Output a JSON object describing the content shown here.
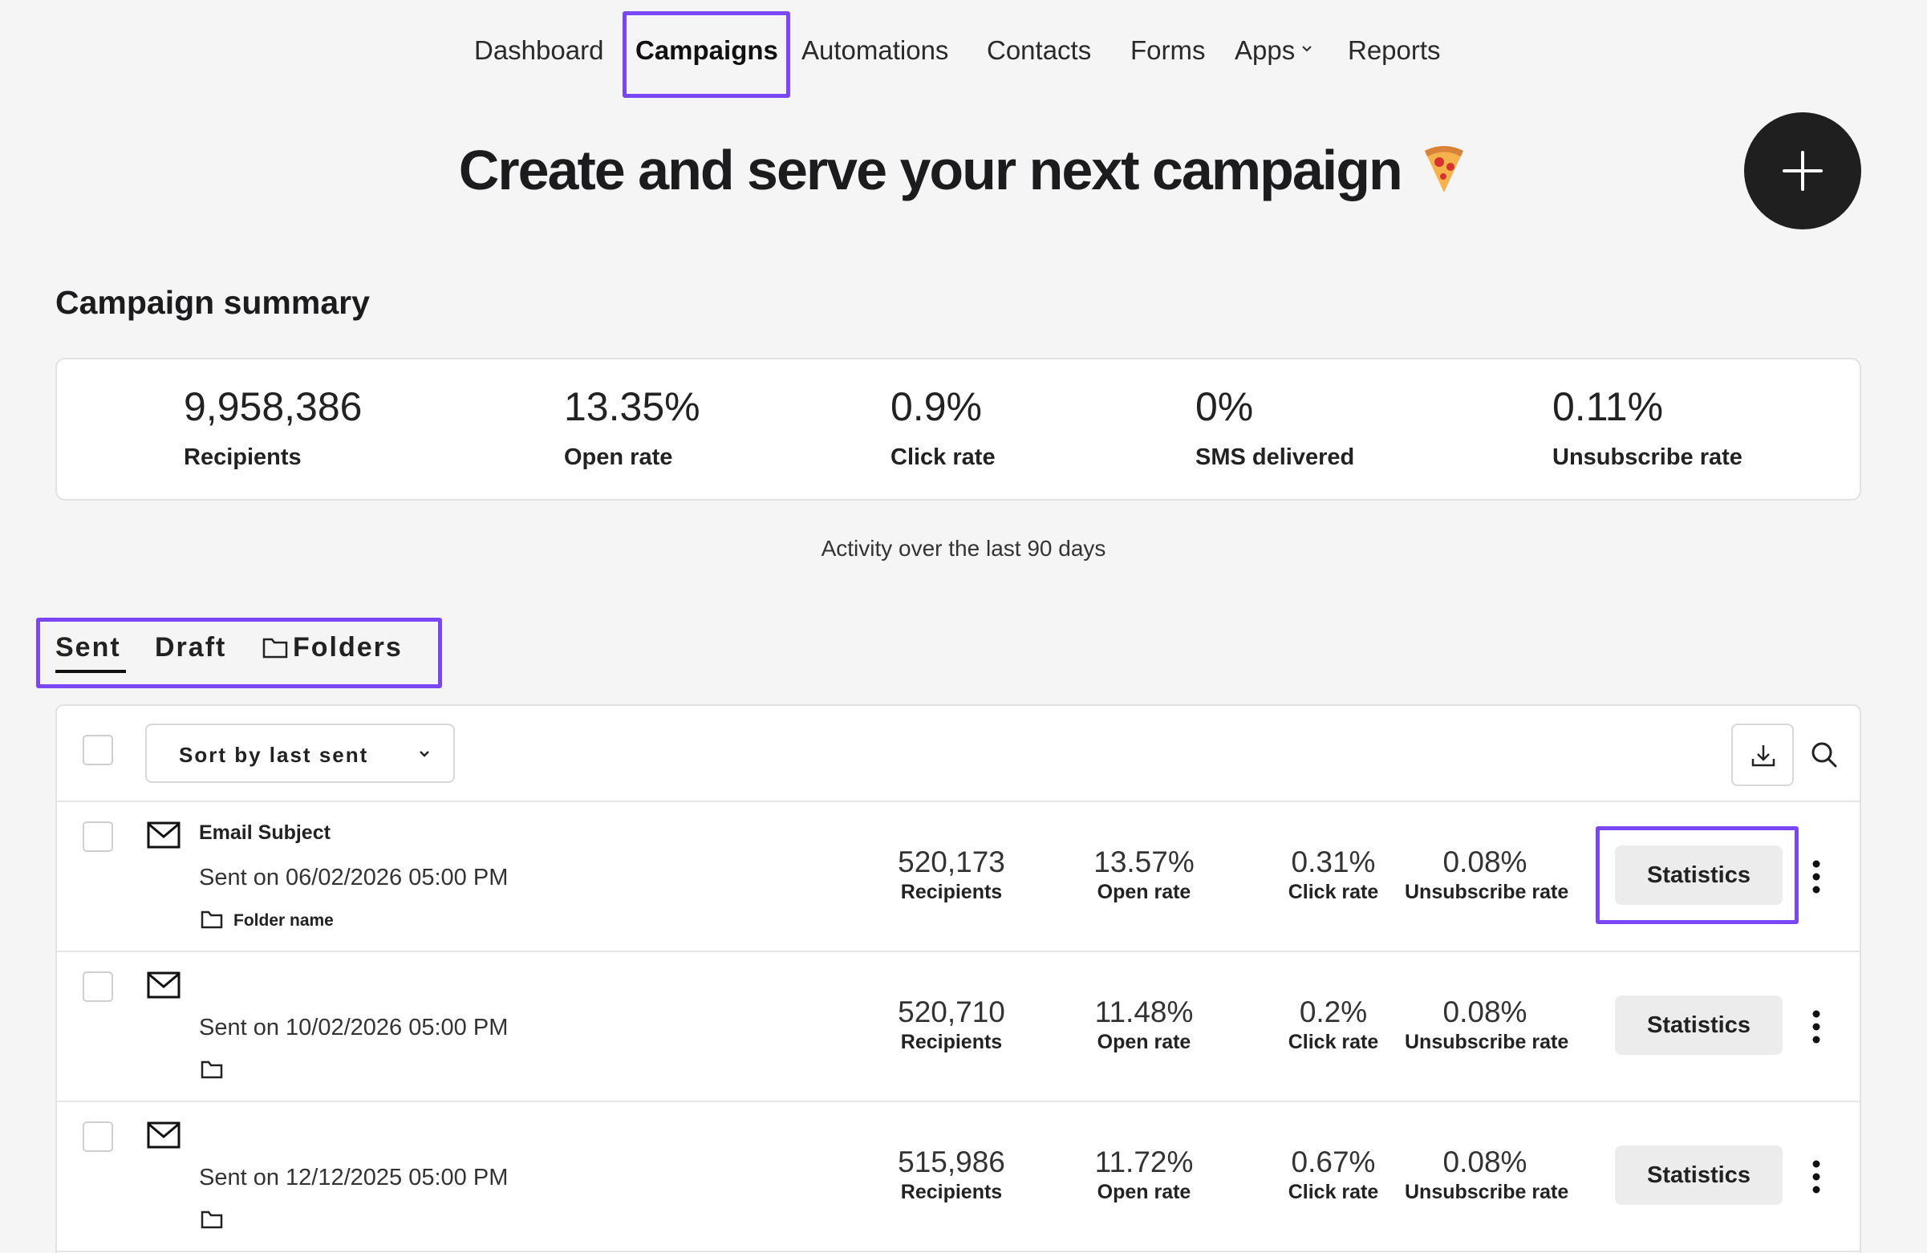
{
  "nav": {
    "items": [
      {
        "label": "Dashboard"
      },
      {
        "label": "Campaigns",
        "active": true
      },
      {
        "label": "Automations"
      },
      {
        "label": "Contacts"
      },
      {
        "label": "Forms"
      },
      {
        "label": "Apps",
        "has_dropdown": true
      },
      {
        "label": "Reports"
      }
    ]
  },
  "hero": {
    "title": "Create and serve your next campaign",
    "emoji": "pizza"
  },
  "fab": {
    "icon": "plus-icon"
  },
  "summary": {
    "title": "Campaign summary",
    "stats": [
      {
        "value": "9,958,386",
        "label": "Recipients"
      },
      {
        "value": "13.35%",
        "label": "Open rate"
      },
      {
        "value": "0.9%",
        "label": "Click rate"
      },
      {
        "value": "0%",
        "label": "SMS delivered"
      },
      {
        "value": "0.11%",
        "label": "Unsubscribe rate"
      }
    ],
    "activity_note": "Activity over the last 90 days"
  },
  "tabs": [
    {
      "label": "Sent",
      "active": true
    },
    {
      "label": "Draft"
    },
    {
      "label": "Folders",
      "icon": "folder-icon"
    }
  ],
  "toolbar": {
    "sort_label": "Sort by last sent",
    "download_icon": "download-icon",
    "search_icon": "search-icon"
  },
  "campaigns": [
    {
      "subject": "Email Subject",
      "sent_on": "Sent on 06/02/2026 05:00 PM",
      "folder": "Folder name",
      "recipients": "520,173",
      "recipients_label": "Recipients",
      "open_rate": "13.57%",
      "open_rate_label": "Open rate",
      "click_rate": "0.31%",
      "click_rate_label": "Click rate",
      "unsubscribe_rate": "0.08%",
      "unsubscribe_rate_label": "Unsubscribe rate",
      "action": "Statistics"
    },
    {
      "subject": "",
      "sent_on": "Sent on 10/02/2026 05:00 PM",
      "folder": "",
      "recipients": "520,710",
      "recipients_label": "Recipients",
      "open_rate": "11.48%",
      "open_rate_label": "Open rate",
      "click_rate": "0.2%",
      "click_rate_label": "Click rate",
      "unsubscribe_rate": "0.08%",
      "unsubscribe_rate_label": "Unsubscribe rate",
      "action": "Statistics"
    },
    {
      "subject": "",
      "sent_on": "Sent on 12/12/2025 05:00 PM",
      "folder": "",
      "recipients": "515,986",
      "recipients_label": "Recipients",
      "open_rate": "11.72%",
      "open_rate_label": "Open rate",
      "click_rate": "0.67%",
      "click_rate_label": "Click rate",
      "unsubscribe_rate": "0.08%",
      "unsubscribe_rate_label": "Unsubscribe rate",
      "action": "Statistics"
    }
  ],
  "colors": {
    "highlight": "#7b46f5",
    "fab": "#1f1f1f",
    "background": "#f5f5f5"
  }
}
